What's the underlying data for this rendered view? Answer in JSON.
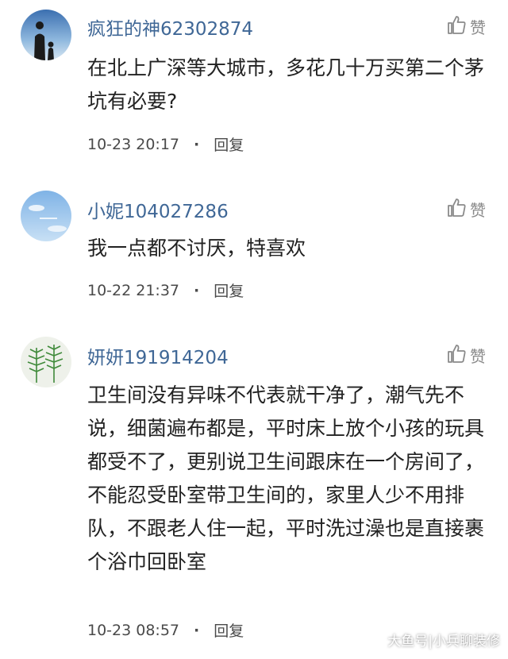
{
  "comments": [
    {
      "username": "疯狂的神62302874",
      "like_label": "赞",
      "text": "在北上广深等大城市，多花几十万买第二个茅坑有必要?",
      "time": "10-23 20:17",
      "separator": "·",
      "reply_label": "回复"
    },
    {
      "username": "小妮104027286",
      "like_label": "赞",
      "text": "我一点都不讨厌，特喜欢",
      "time": "10-22 21:37",
      "separator": "·",
      "reply_label": "回复"
    },
    {
      "username": "妍妍191914204",
      "like_label": "赞",
      "text": "卫生间没有异味不代表就干净了，潮气先不说，细菌遍布都是，平时床上放个小孩的玩具都受不了，更别说卫生间跟床在一个房间了，不能忍受卧室带卫生间的，家里人少不用排队，不跟老人住一起，平时洗过澡也是直接裹个浴巾回卧室",
      "time": "10-23 08:57",
      "separator": "·",
      "reply_label": "回复"
    }
  ],
  "watermark": "大鱼号|小兵聊装修",
  "colors": {
    "username": "#3f6796",
    "text": "#222222",
    "meta": "#4a4a4a",
    "like": "#8a8a8a"
  }
}
